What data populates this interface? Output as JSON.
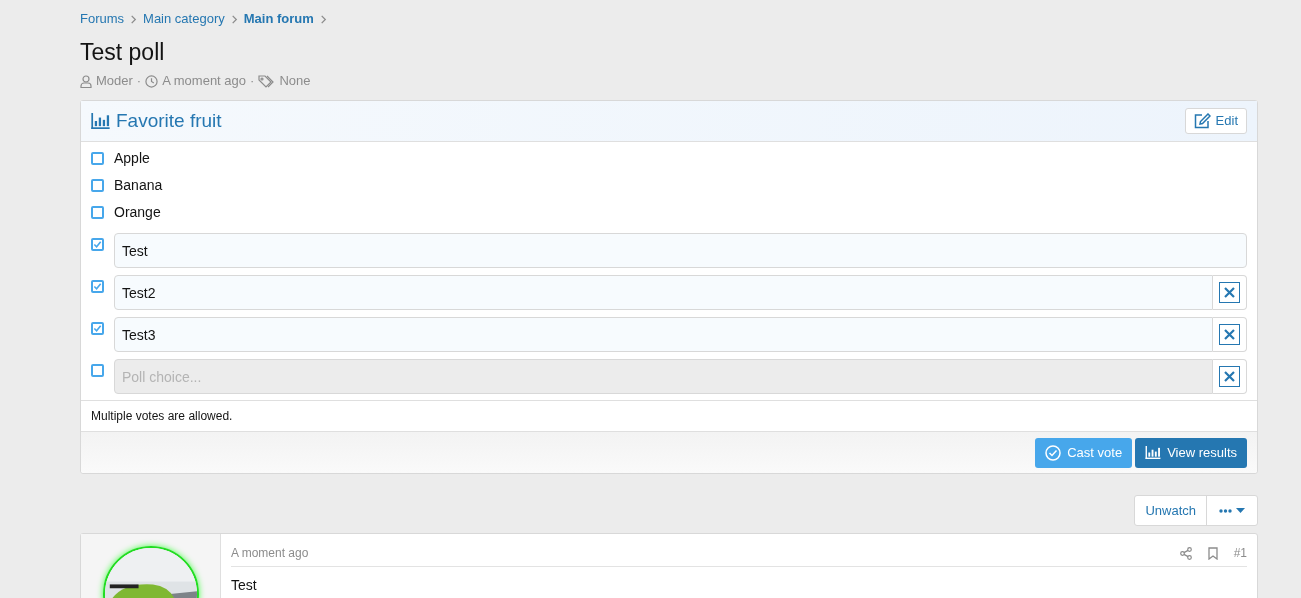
{
  "breadcrumbs": [
    {
      "label": "Forums",
      "current": false
    },
    {
      "label": "Main category",
      "current": false
    },
    {
      "label": "Main forum",
      "current": true
    }
  ],
  "title": "Test poll",
  "meta": {
    "author": "Moder",
    "separator": "·",
    "time": "A moment ago",
    "tags": "None"
  },
  "poll": {
    "title": "Favorite fruit",
    "edit_button": "Edit",
    "choices": [
      {
        "kind": "static",
        "label": "Apple",
        "checked": false
      },
      {
        "kind": "static",
        "label": "Banana",
        "checked": false
      },
      {
        "kind": "static",
        "label": "Orange",
        "checked": false
      },
      {
        "kind": "input",
        "value": "Test",
        "checked": true,
        "removable": false
      },
      {
        "kind": "input",
        "value": "Test2",
        "checked": true,
        "removable": true
      },
      {
        "kind": "input",
        "value": "Test3",
        "checked": true,
        "removable": true
      },
      {
        "kind": "input",
        "placeholder": "Poll choice...",
        "checked": false,
        "removable": true
      }
    ],
    "note": "Multiple votes are allowed.",
    "cast_button": "Cast vote",
    "results_button": "View results"
  },
  "thread_actions": {
    "watch_button": "Unwatch"
  },
  "post": {
    "time": "A moment ago",
    "number": "#1",
    "body": "Test"
  }
}
